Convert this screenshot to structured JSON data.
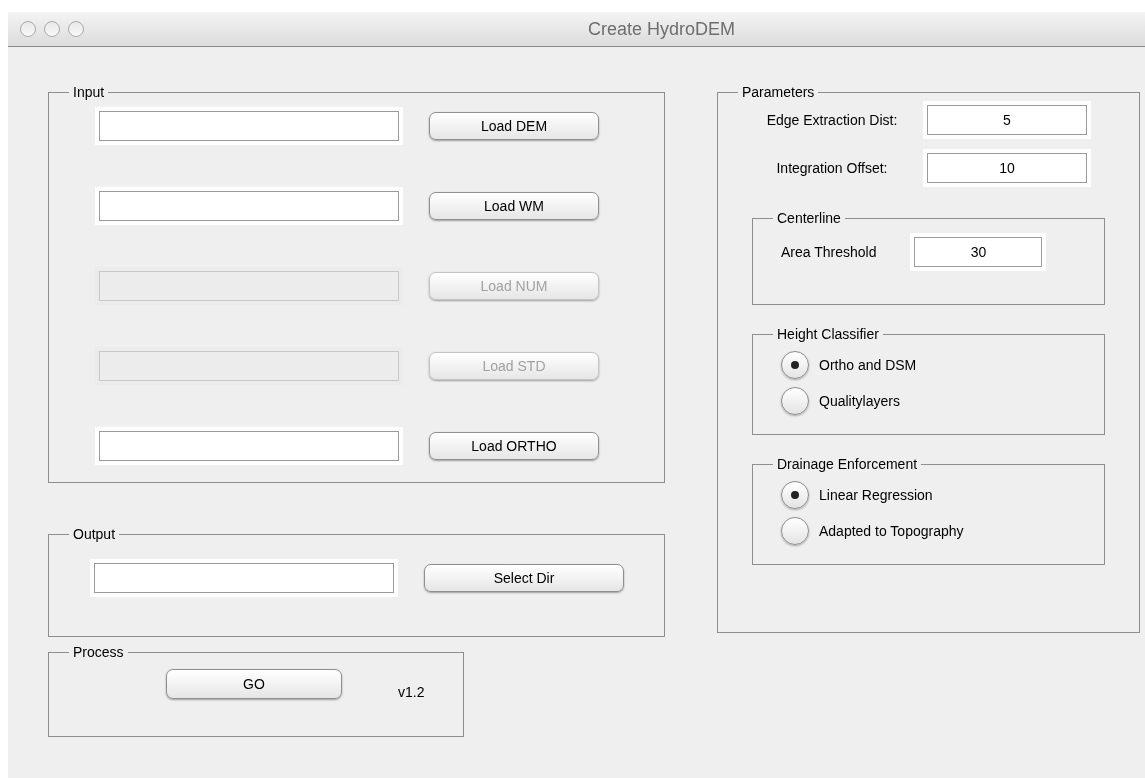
{
  "window": {
    "title": "Create HydroDEM"
  },
  "input": {
    "title": "Input",
    "rows": [
      {
        "button": "Load DEM",
        "disabled": false
      },
      {
        "button": "Load WM",
        "disabled": false
      },
      {
        "button": "Load NUM",
        "disabled": true
      },
      {
        "button": "Load STD",
        "disabled": true
      },
      {
        "button": "Load ORTHO",
        "disabled": false
      }
    ]
  },
  "output": {
    "title": "Output",
    "button": "Select Dir"
  },
  "process": {
    "title": "Process",
    "button": "GO",
    "version": "v1.2"
  },
  "parameters": {
    "title": "Parameters",
    "fields": [
      {
        "label": "Edge Extraction Dist:",
        "value": "5"
      },
      {
        "label": "Integration Offset:",
        "value": "10"
      }
    ],
    "centerline": {
      "title": "Centerline",
      "label": "Area Threshold",
      "value": "30"
    },
    "groups": [
      {
        "title": "Height Classifier",
        "options": [
          {
            "label": "Ortho and DSM",
            "selected": true
          },
          {
            "label": "Qualitylayers",
            "selected": false
          }
        ]
      },
      {
        "title": "Drainage Enforcement",
        "options": [
          {
            "label": "Linear Regression",
            "selected": true
          },
          {
            "label": "Adapted to Topography",
            "selected": false
          }
        ]
      }
    ]
  }
}
